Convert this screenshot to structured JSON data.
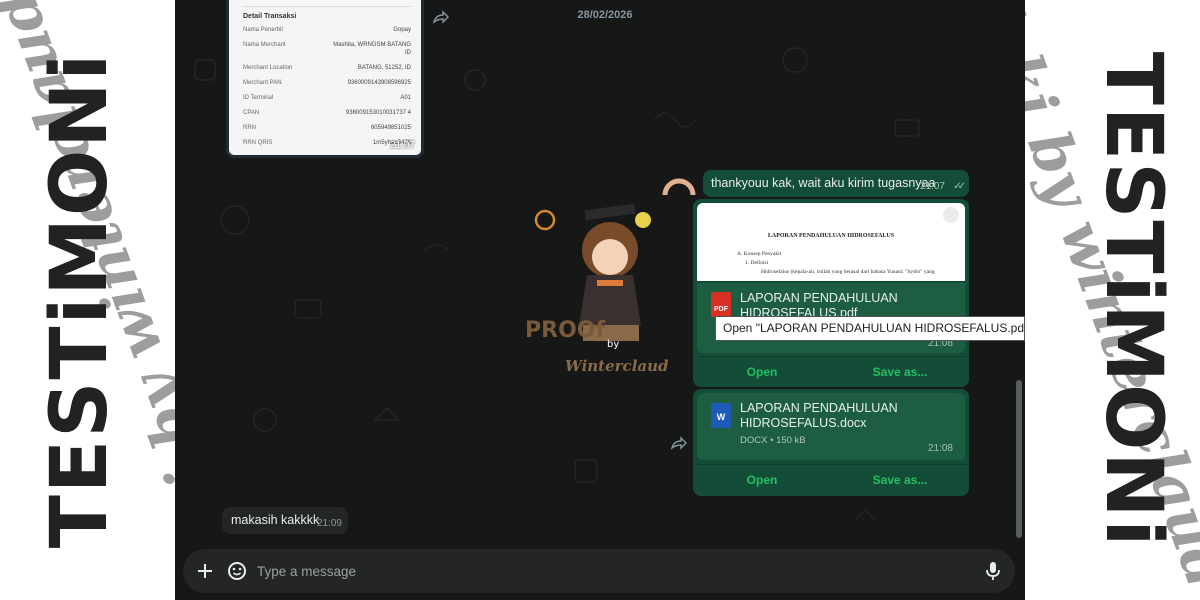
{
  "banner": {
    "title": "TESTiMONi",
    "script": "Joki by winterclaud"
  },
  "chat": {
    "date": "28/02/2026",
    "receipt": {
      "heading": "Detail Transaksi",
      "rows": [
        {
          "label": "Nama Penerbit",
          "value": "Gopay"
        },
        {
          "label": "Nama Merchant",
          "value": "Mashita, WRNGSM BATANG ID"
        },
        {
          "label": "Merchant Location",
          "value": "BATANG, 51252, ID"
        },
        {
          "label": "Merchant PAN",
          "value": "9360009143908596925"
        },
        {
          "label": "ID Terminal",
          "value": "A01"
        },
        {
          "label": "CPAN",
          "value": "936009153010031737 4"
        },
        {
          "label": "RRN",
          "value": "605949851025"
        },
        {
          "label": "RRN QRIS",
          "value": "1m5yhao3476"
        }
      ],
      "time": "21:07"
    },
    "watermark": {
      "line1": "PROOf",
      "line2": "by",
      "line3": "Winterclaud"
    },
    "messages": [
      {
        "text": "thankyouu kak, wait aku kirim tugasnyaa",
        "time": "21:07"
      }
    ],
    "pdf": {
      "preview_title": "LAPORAN PENDAHULUAN HIDROSEFALUS",
      "preview_lines": [
        "A.  Konsep Penyakit",
        "1.  Definisi",
        "Hidrosefalus (kepala-air, istilah yang berasal dari bahasa Yunani: \"hydro\" yang"
      ],
      "icon_label": "PDF",
      "name": "LAPORAN PENDAHULUAN HIDROSEFALUS.pdf",
      "time": "21:08",
      "open": "Open",
      "save": "Save as..."
    },
    "tooltip": "Open \"LAPORAN PENDAHULUAN HIDROSEFALUS.pdf\"",
    "docx": {
      "icon_label": "W",
      "name": "LAPORAN PENDAHULUAN HIDROSEFALUS.docx",
      "type": "DOCX",
      "dot": "•",
      "size": "150 kB",
      "time": "21:08",
      "open": "Open",
      "save": "Save as..."
    },
    "incoming": {
      "text": "makasih kakkkk",
      "time": "21:09"
    },
    "composer": {
      "placeholder": "Type a message"
    }
  },
  "colors": {
    "chat_bg": "#161717",
    "outgoing": "#144d37",
    "accent": "#21c063",
    "pdf_red": "#d93025",
    "word_blue": "#1e5bb8"
  }
}
